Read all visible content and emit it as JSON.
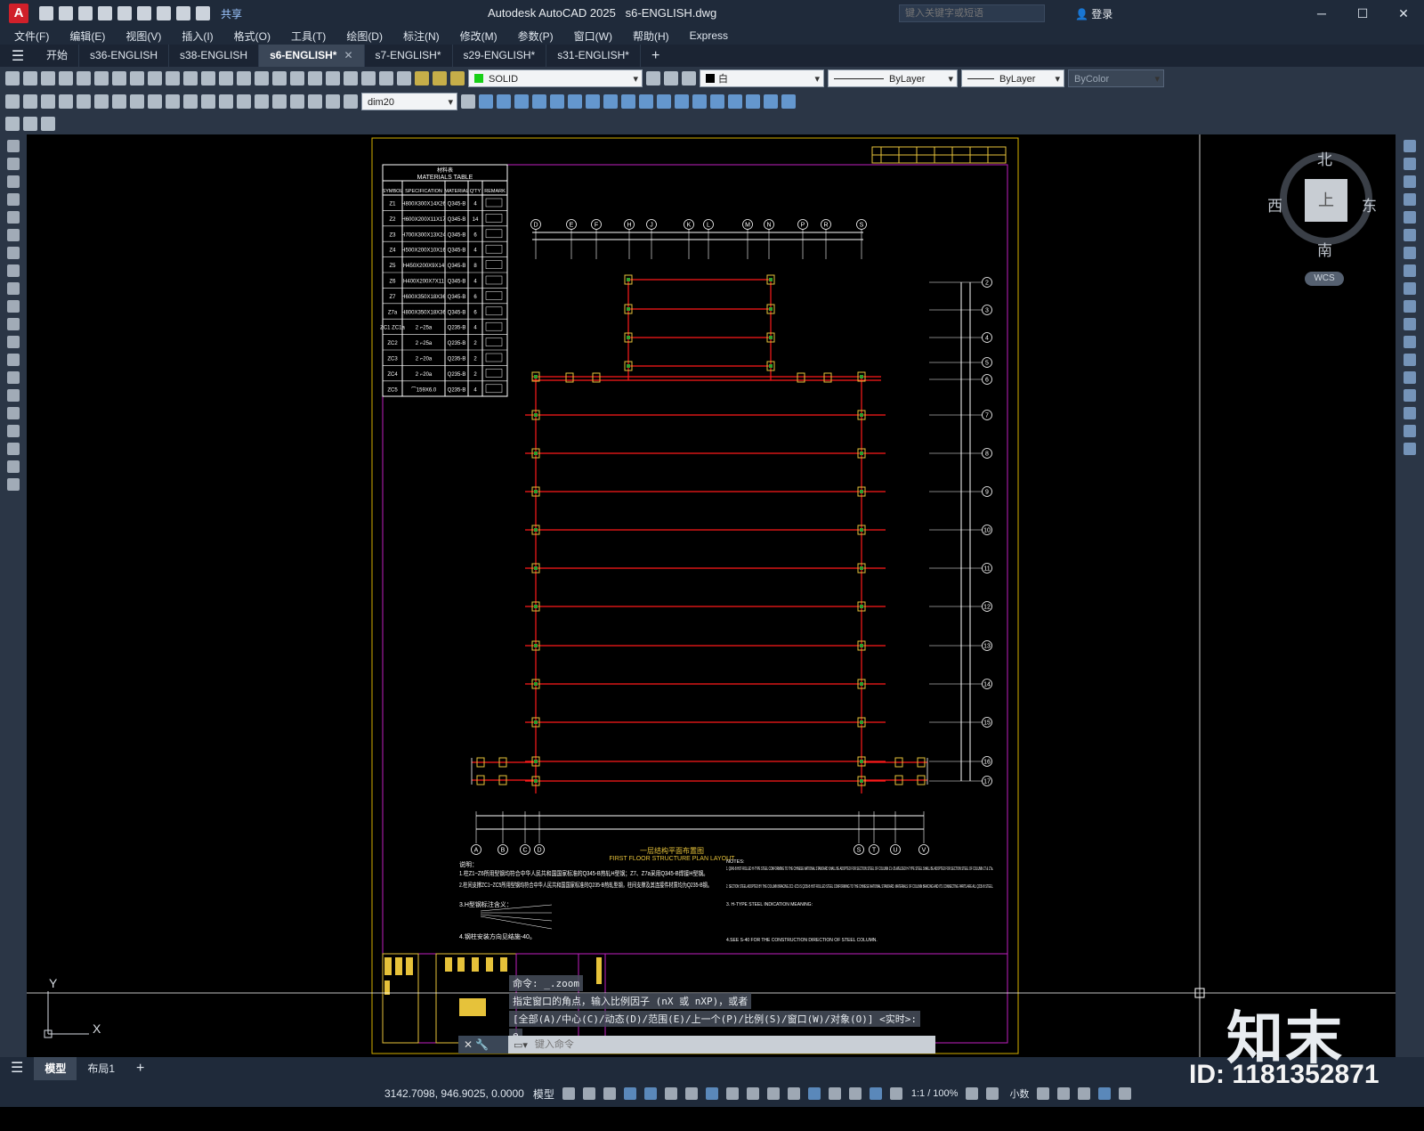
{
  "title_bar": {
    "app_letter": "A",
    "share_label": "共享",
    "window_title": "Autodesk AutoCAD 2025",
    "file_name": "s6-ENGLISH.dwg",
    "search_placeholder": "键入关键字或短语",
    "login_label": "登录"
  },
  "menu": [
    "文件(F)",
    "编辑(E)",
    "视图(V)",
    "插入(I)",
    "格式(O)",
    "工具(T)",
    "绘图(D)",
    "标注(N)",
    "修改(M)",
    "参数(P)",
    "窗口(W)",
    "帮助(H)",
    "Express"
  ],
  "file_tabs": [
    {
      "label": "开始",
      "active": false,
      "closable": false
    },
    {
      "label": "s36-ENGLISH",
      "active": false,
      "closable": false
    },
    {
      "label": "s38-ENGLISH",
      "active": false,
      "closable": false
    },
    {
      "label": "s6-ENGLISH*",
      "active": true,
      "closable": true
    },
    {
      "label": "s7-ENGLISH*",
      "active": false,
      "closable": false
    },
    {
      "label": "s29-ENGLISH*",
      "active": false,
      "closable": false
    },
    {
      "label": "s31-ENGLISH*",
      "active": false,
      "closable": false
    }
  ],
  "properties": {
    "layer": "SOLID",
    "color": "白",
    "linetype": "ByLayer",
    "lineweight": "ByLayer",
    "plotstyle": "ByColor",
    "dimstyle": "dim20"
  },
  "viewcube": {
    "north": "北",
    "south": "南",
    "west": "西",
    "east": "东",
    "face": "上",
    "wcs": "WCS"
  },
  "ucs": {
    "x": "X",
    "y": "Y"
  },
  "drawing": {
    "table_title_cn": "材料表",
    "table_title": "MATERIALS TABLE",
    "table_headers": [
      "SYMBOL",
      "SPECIFICATION",
      "MATERIAL",
      "Q'TY",
      "REMARK"
    ],
    "table_rows": [
      [
        "Z1",
        "H800X300X14X26",
        "Q345-B",
        "4"
      ],
      [
        "Z2",
        "H600X200X11X17",
        "Q345-B",
        "14"
      ],
      [
        "Z3",
        "H700X300X13X24",
        "Q345-B",
        "6"
      ],
      [
        "Z4",
        "H500X200X10X16",
        "Q345-B",
        "4"
      ],
      [
        "Z5",
        "H450X200X9X14",
        "Q345-B",
        "8"
      ],
      [
        "Z6",
        "H400X200X7X11",
        "Q345-B",
        "4"
      ],
      [
        "Z7",
        "H600X350X18X36",
        "Q345-B",
        "6"
      ],
      [
        "Z7a",
        "H800X350X18X36",
        "Q345-B",
        "6"
      ],
      [
        "ZC1 ZC1a",
        "2 ⌐25a",
        "Q235-B",
        "4"
      ],
      [
        "ZC2",
        "2 ⌐25a",
        "Q235-B",
        "2"
      ],
      [
        "ZC3",
        "2 ⌐20a",
        "Q235-B",
        "2"
      ],
      [
        "ZC4",
        "2 ⌐20a",
        "Q235-B",
        "2"
      ],
      [
        "ZC5",
        "⌒159X6.0",
        "Q235-B",
        "4"
      ]
    ],
    "top_axes": [
      "D",
      "E",
      "F",
      "H",
      "J",
      "K",
      "L",
      "M",
      "N",
      "P",
      "R",
      "S"
    ],
    "bottom_axes": [
      "A",
      "B",
      "C",
      "D",
      "S",
      "T",
      "U",
      "V"
    ],
    "right_axes": [
      "2",
      "3",
      "4",
      "5",
      "6",
      "7",
      "8",
      "9",
      "10",
      "11",
      "12",
      "13",
      "14",
      "15",
      "16",
      "17"
    ],
    "plan_title_cn": "一层结构平面布置图",
    "plan_title": "FIRST FLOOR STRUCTURE PLAN LAYOUT",
    "notes_cn": [
      "说明：",
      "1.柱Z1~Z6所用型钢均符合中华人民共和国国家标准的Q345-B热轧H型钢；Z7、Z7a采用Q345-B焊接H型钢。",
      "2.柱间支撑ZC1~ZC5所用型钢均符合中华人民共和国国家标准的Q235-B热轧型钢，柱间支撑及其连接件材质均为Q235-B钢。",
      "3.H型钢标注含义：",
      "4.钢柱安装方向见结施-40。"
    ],
    "notes_en": [
      "NOTES:",
      "1. Q345-B HOT-ROLLED H-TYPE STEEL CONFORMING TO THE CHINESE NATIONAL STANDARD SHALL BE ADOPTED FOR SECTION STEEL OF COLUMN Z1~Z6.WELDED H-TYPE STEEL SHALL BE ADOPTED FOR SECTION STEEL OF COLUMN Z7 & Z7a.",
      "2. SECTION STEEL ADOPTED BY THE COLUMN BRACING ZC1~ZC5 IS Q235-B HOT-ROLLED STEEL CONFORMING TO THE CHINESE NATIONAL STANDARD. MATERIALS OF COLUMN BRACING AND ITS CONNECTING PARTS ARE ALL Q235-B STEEL.",
      "3. H-TYPE STEEL INDICATION MEANING:",
      "4.SEE S-40 FOR THE CONSTRUCTION DIRECTION OF STEEL COLUMN."
    ]
  },
  "command": {
    "history": [
      "命令: _.zoom",
      "指定窗口的角点，输入比例因子 (nX 或 nXP)，或者",
      "[全部(A)/中心(C)/动态(D)/范围(E)/上一个(P)/比例(S)/窗口(W)/对象(O)] <实时>:",
      "e"
    ],
    "placeholder": "键入命令"
  },
  "layout_tabs": [
    "模型",
    "布局1"
  ],
  "status": {
    "coords": "3142.7098, 946.9025, 0.0000",
    "model": "模型",
    "scale": "1:1 / 100%",
    "units": "小数"
  },
  "watermark": {
    "logo": "知末",
    "id": "ID: 1181352871"
  },
  "colors": {
    "beam": "#ff1a1a",
    "column": "#e6c23a",
    "frame": "#c020c0",
    "line": "#ffffff",
    "ui_bg": "#2b3646"
  }
}
